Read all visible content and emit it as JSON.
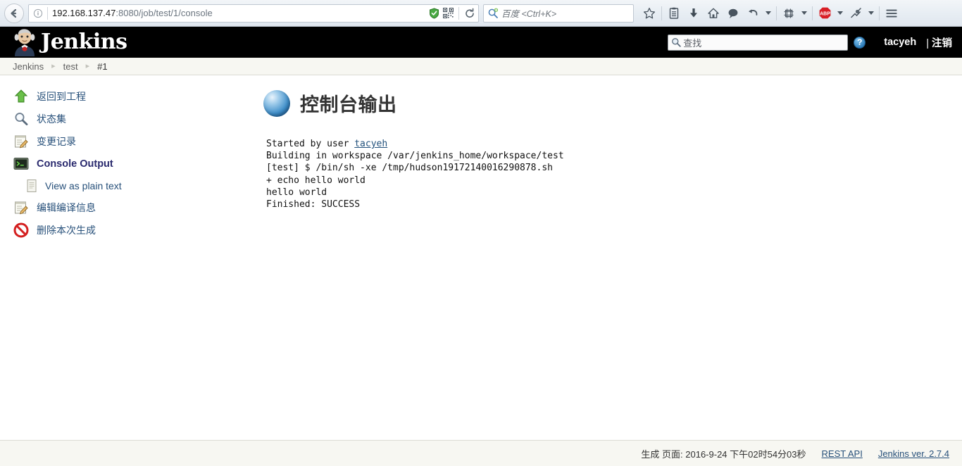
{
  "browser": {
    "back_icon": "back-arrow-icon",
    "info_icon": "page-info-icon",
    "url_host": "192.168.137.47",
    "url_rest": ":8080/job/test/1/console",
    "shield_icon": "security-shield-icon",
    "qrcode_icon": "qrcode-icon",
    "reload_icon": "reload-icon",
    "search_placeholder": "百度 <Ctrl+K>",
    "search_engine_icon": "baidu-search-icon",
    "toolbar_icons": [
      "bookmark-star-icon",
      "reading-list-icon",
      "downloads-icon",
      "home-icon",
      "chat-bubble-icon",
      "undo-icon",
      "screenshot-icon",
      "adblock-plus-icon",
      "plugin-icon",
      "menu-hamburger-icon"
    ]
  },
  "header": {
    "brand": "Jenkins",
    "logo_icon": "jenkins-butler-logo",
    "search_placeholder": "查找",
    "search_icon": "search-icon",
    "help_icon": "help-icon",
    "help_label": "?",
    "user": "tacyeh",
    "logout": "注销",
    "logout_separator": "|"
  },
  "breadcrumb": {
    "items": [
      {
        "label": "Jenkins"
      },
      {
        "label": "test"
      },
      {
        "label": "#1"
      }
    ],
    "separator": "▸"
  },
  "sidebar": {
    "items": [
      {
        "label": "返回到工程",
        "icon": "up-arrow-icon",
        "active": false
      },
      {
        "label": "状态集",
        "icon": "magnifier-icon",
        "active": false
      },
      {
        "label": "变更记录",
        "icon": "notepad-edit-icon",
        "active": false
      },
      {
        "label": "Console Output",
        "icon": "terminal-icon",
        "active": true
      },
      {
        "label": "编辑编译信息",
        "icon": "notepad-edit-icon",
        "active": false
      },
      {
        "label": "删除本次生成",
        "icon": "delete-forbidden-icon",
        "active": false
      }
    ],
    "sub_item": {
      "label": "View as plain text",
      "icon": "document-icon"
    }
  },
  "main": {
    "title": "控制台输出",
    "title_icon": "blue-orb-icon",
    "console": {
      "line1_prefix": "Started by user ",
      "line1_link": "tacyeh",
      "lines": [
        "Building in workspace /var/jenkins_home/workspace/test",
        "[test] $ /bin/sh -xe /tmp/hudson19172140016290878.sh",
        "+ echo hello world",
        "hello world",
        "Finished: SUCCESS"
      ]
    }
  },
  "footer": {
    "generated": "生成 页面: 2016-9-24 下午02时54分03秒",
    "rest_api": "REST API",
    "version": "Jenkins ver. 2.7.4"
  },
  "colors": {
    "header_bg": "#000000",
    "link": "#27507a",
    "breadcrumb_bg": "#f7f7f2",
    "accent_green": "#4b9e28",
    "accent_red": "#d02020"
  }
}
